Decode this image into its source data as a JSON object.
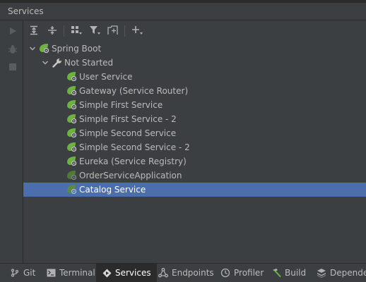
{
  "window": {
    "title": "Services"
  },
  "tree": {
    "root": {
      "label": "Spring Boot",
      "icon": "spring-boot-icon"
    },
    "group": {
      "label": "Not Started",
      "icon": "wrench-icon"
    },
    "items": [
      {
        "label": "User Service",
        "icon": "spring-boot-icon"
      },
      {
        "label": "Gateway (Service Router)",
        "icon": "spring-boot-icon"
      },
      {
        "label": "Simple First Service",
        "icon": "spring-boot-icon"
      },
      {
        "label": "Simple First Service - 2",
        "icon": "spring-boot-icon"
      },
      {
        "label": "Simple Second Service",
        "icon": "spring-boot-icon"
      },
      {
        "label": "Simple Second Service - 2",
        "icon": "spring-boot-icon"
      },
      {
        "label": "Eureka (Service Registry)",
        "icon": "spring-boot-icon"
      },
      {
        "label": "OrderServiceApplication",
        "icon": "spring-boot-icon-dim"
      },
      {
        "label": "Catalog Service",
        "icon": "spring-boot-icon-dim",
        "selected": true
      }
    ]
  },
  "bottom_tabs": [
    {
      "label": "Git",
      "icon": "git-branch-icon"
    },
    {
      "label": "Terminal",
      "icon": "terminal-icon"
    },
    {
      "label": "Services",
      "icon": "services-icon",
      "active": true
    },
    {
      "label": "Endpoints",
      "icon": "endpoints-icon"
    },
    {
      "label": "Profiler",
      "icon": "profiler-icon"
    },
    {
      "label": "Build",
      "icon": "hammer-icon"
    },
    {
      "label": "Dependen",
      "icon": "dependencies-icon"
    }
  ],
  "colors": {
    "background": "#3c3f41",
    "selection": "#4b6eaf",
    "spring_green": "#6db33f",
    "text": "#bbbbbb"
  }
}
